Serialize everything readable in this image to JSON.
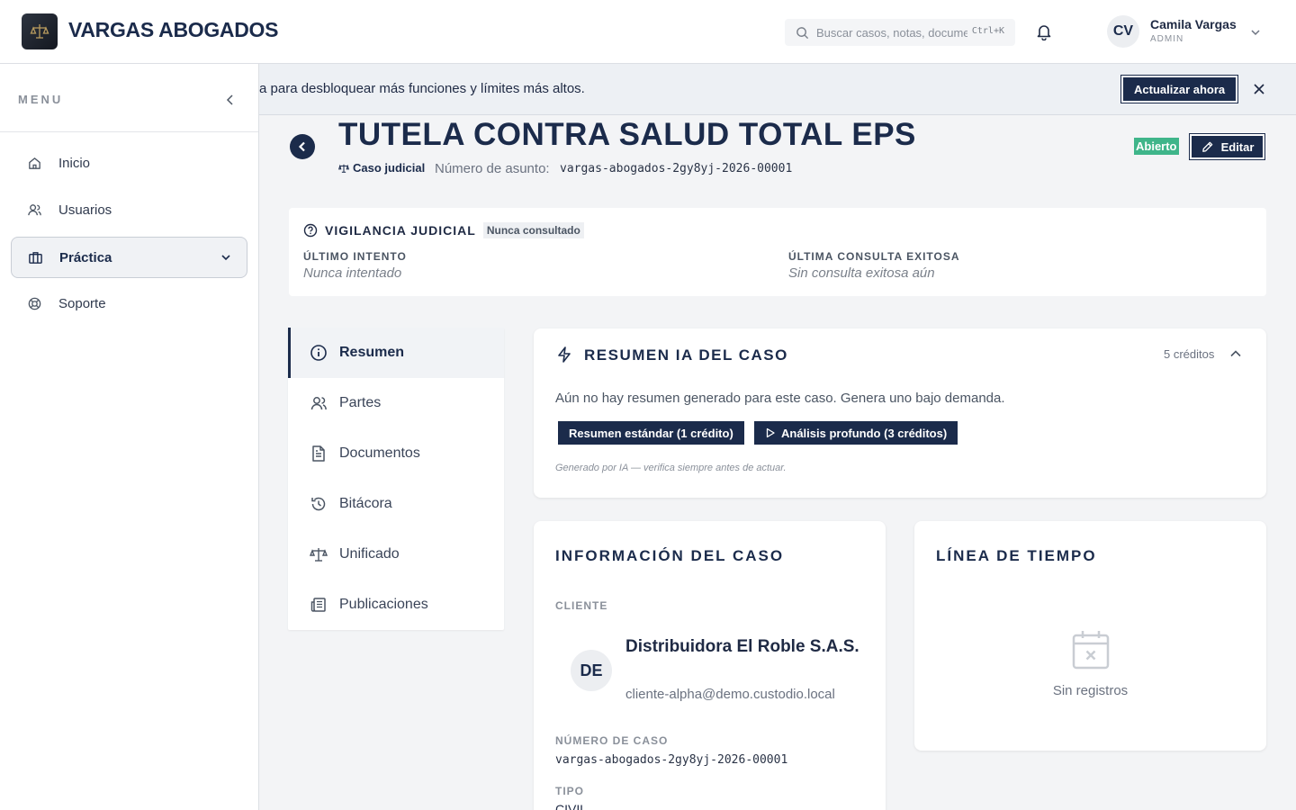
{
  "header": {
    "brand": "VARGAS ABOGADOS",
    "search_placeholder": "Buscar casos, notas, documentos...",
    "search_shortcut": "Ctrl+K",
    "user_initials": "CV",
    "user_name": "Camila Vargas",
    "user_role": "ADMIN"
  },
  "sidebar": {
    "title": "MENU",
    "items": [
      {
        "label": "Inicio",
        "icon": "home-icon"
      },
      {
        "label": "Usuarios",
        "icon": "users-icon"
      },
      {
        "label": "Práctica",
        "icon": "briefcase-icon",
        "active": true
      },
      {
        "label": "Soporte",
        "icon": "lifebuoy-icon"
      }
    ]
  },
  "banner": {
    "text": "a para desbloquear más funciones y límites más altos.",
    "cta": "Actualizar ahora"
  },
  "case": {
    "title": "TUTELA CONTRA SALUD TOTAL EPS",
    "type": "Caso judicial",
    "number_label": "Número de asunto:",
    "number": "vargas-abogados-2gy8yj-2026-00001",
    "status": "Abierto",
    "edit_label": "Editar"
  },
  "vigilance": {
    "title": "VIGILANCIA JUDICIAL",
    "badge": "Nunca consultado",
    "last_attempt_label": "ÚLTIMO INTENTO",
    "last_attempt_value": "Nunca intentado",
    "last_success_label": "ÚLTIMA CONSULTA EXITOSA",
    "last_success_value": "Sin consulta exitosa aún"
  },
  "tabs": [
    {
      "label": "Resumen",
      "icon": "info-icon",
      "active": true
    },
    {
      "label": "Partes",
      "icon": "users-icon"
    },
    {
      "label": "Documentos",
      "icon": "document-icon"
    },
    {
      "label": "Bitácora",
      "icon": "history-icon"
    },
    {
      "label": "Unificado",
      "icon": "scale-icon"
    },
    {
      "label": "Publicaciones",
      "icon": "newspaper-icon"
    }
  ],
  "summary": {
    "title": "RESUMEN IA DEL CASO",
    "credits": "5 créditos",
    "text": "Aún no hay resumen generado para este caso. Genera uno bajo demanda.",
    "btn_standard": "Resumen estándar (1 crédito)",
    "btn_deep": "Análisis profundo (3 créditos)",
    "note": "Generado por IA — verifica siempre antes de actuar."
  },
  "info": {
    "title": "INFORMACIÓN DEL CASO",
    "client_label": "CLIENTE",
    "client_initials": "DE",
    "client_name": "Distribuidora El Roble S.A.S.",
    "client_email": "cliente-alpha@demo.custodio.local",
    "case_number_label": "NÚMERO DE CASO",
    "case_number": "vargas-abogados-2gy8yj-2026-00001",
    "type_label": "TIPO",
    "type_value": "CIVIL"
  },
  "timeline": {
    "title": "LÍNEA DE TIEMPO",
    "empty": "Sin registros"
  },
  "colors": {
    "navy": "#1b2b4b",
    "status_green": "#3fb58a"
  }
}
